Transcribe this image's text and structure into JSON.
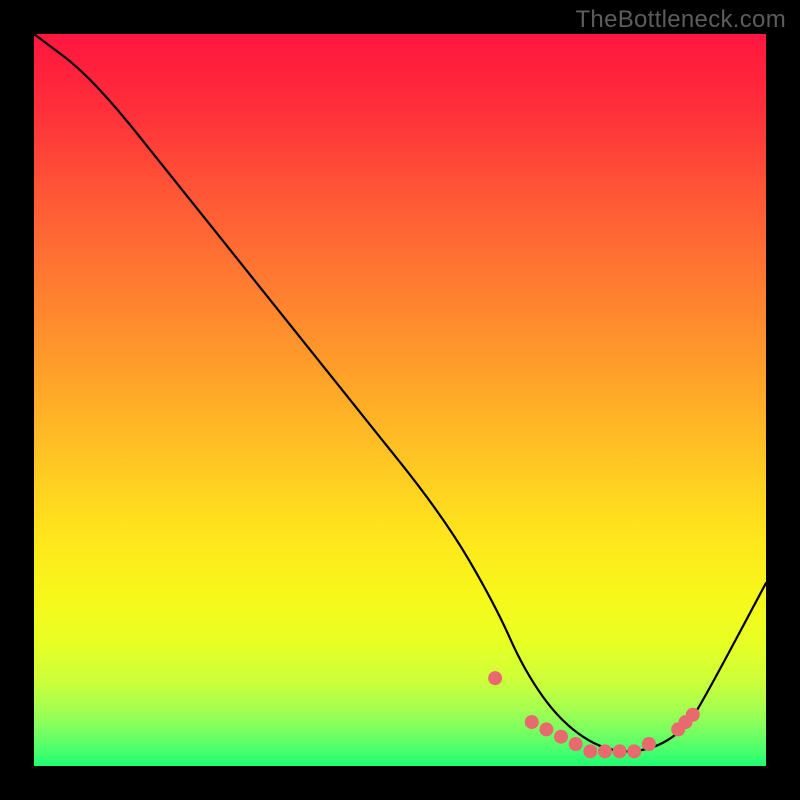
{
  "watermark": "TheBottleneck.com",
  "chart_data": {
    "type": "line",
    "title": "",
    "xlabel": "",
    "ylabel": "",
    "xlim": [
      0,
      100
    ],
    "ylim": [
      0,
      100
    ],
    "series": [
      {
        "name": "curve",
        "x": [
          0,
          8,
          20,
          32,
          44,
          56,
          63,
          67,
          72,
          78,
          84,
          89,
          92,
          100
        ],
        "values": [
          100,
          94,
          79,
          64,
          49,
          34,
          22,
          13,
          6,
          2,
          2,
          5,
          10,
          25
        ]
      }
    ],
    "dots": {
      "x": [
        63,
        68,
        70,
        72,
        74,
        76,
        78,
        80,
        82,
        84,
        88,
        89,
        90
      ],
      "values": [
        12,
        6,
        5,
        4,
        3,
        2,
        2,
        2,
        2,
        3,
        5,
        6,
        7
      ],
      "color": "#e96a6e",
      "radius": 7
    },
    "curve_color": "#000000",
    "curve_width": 2.2
  }
}
